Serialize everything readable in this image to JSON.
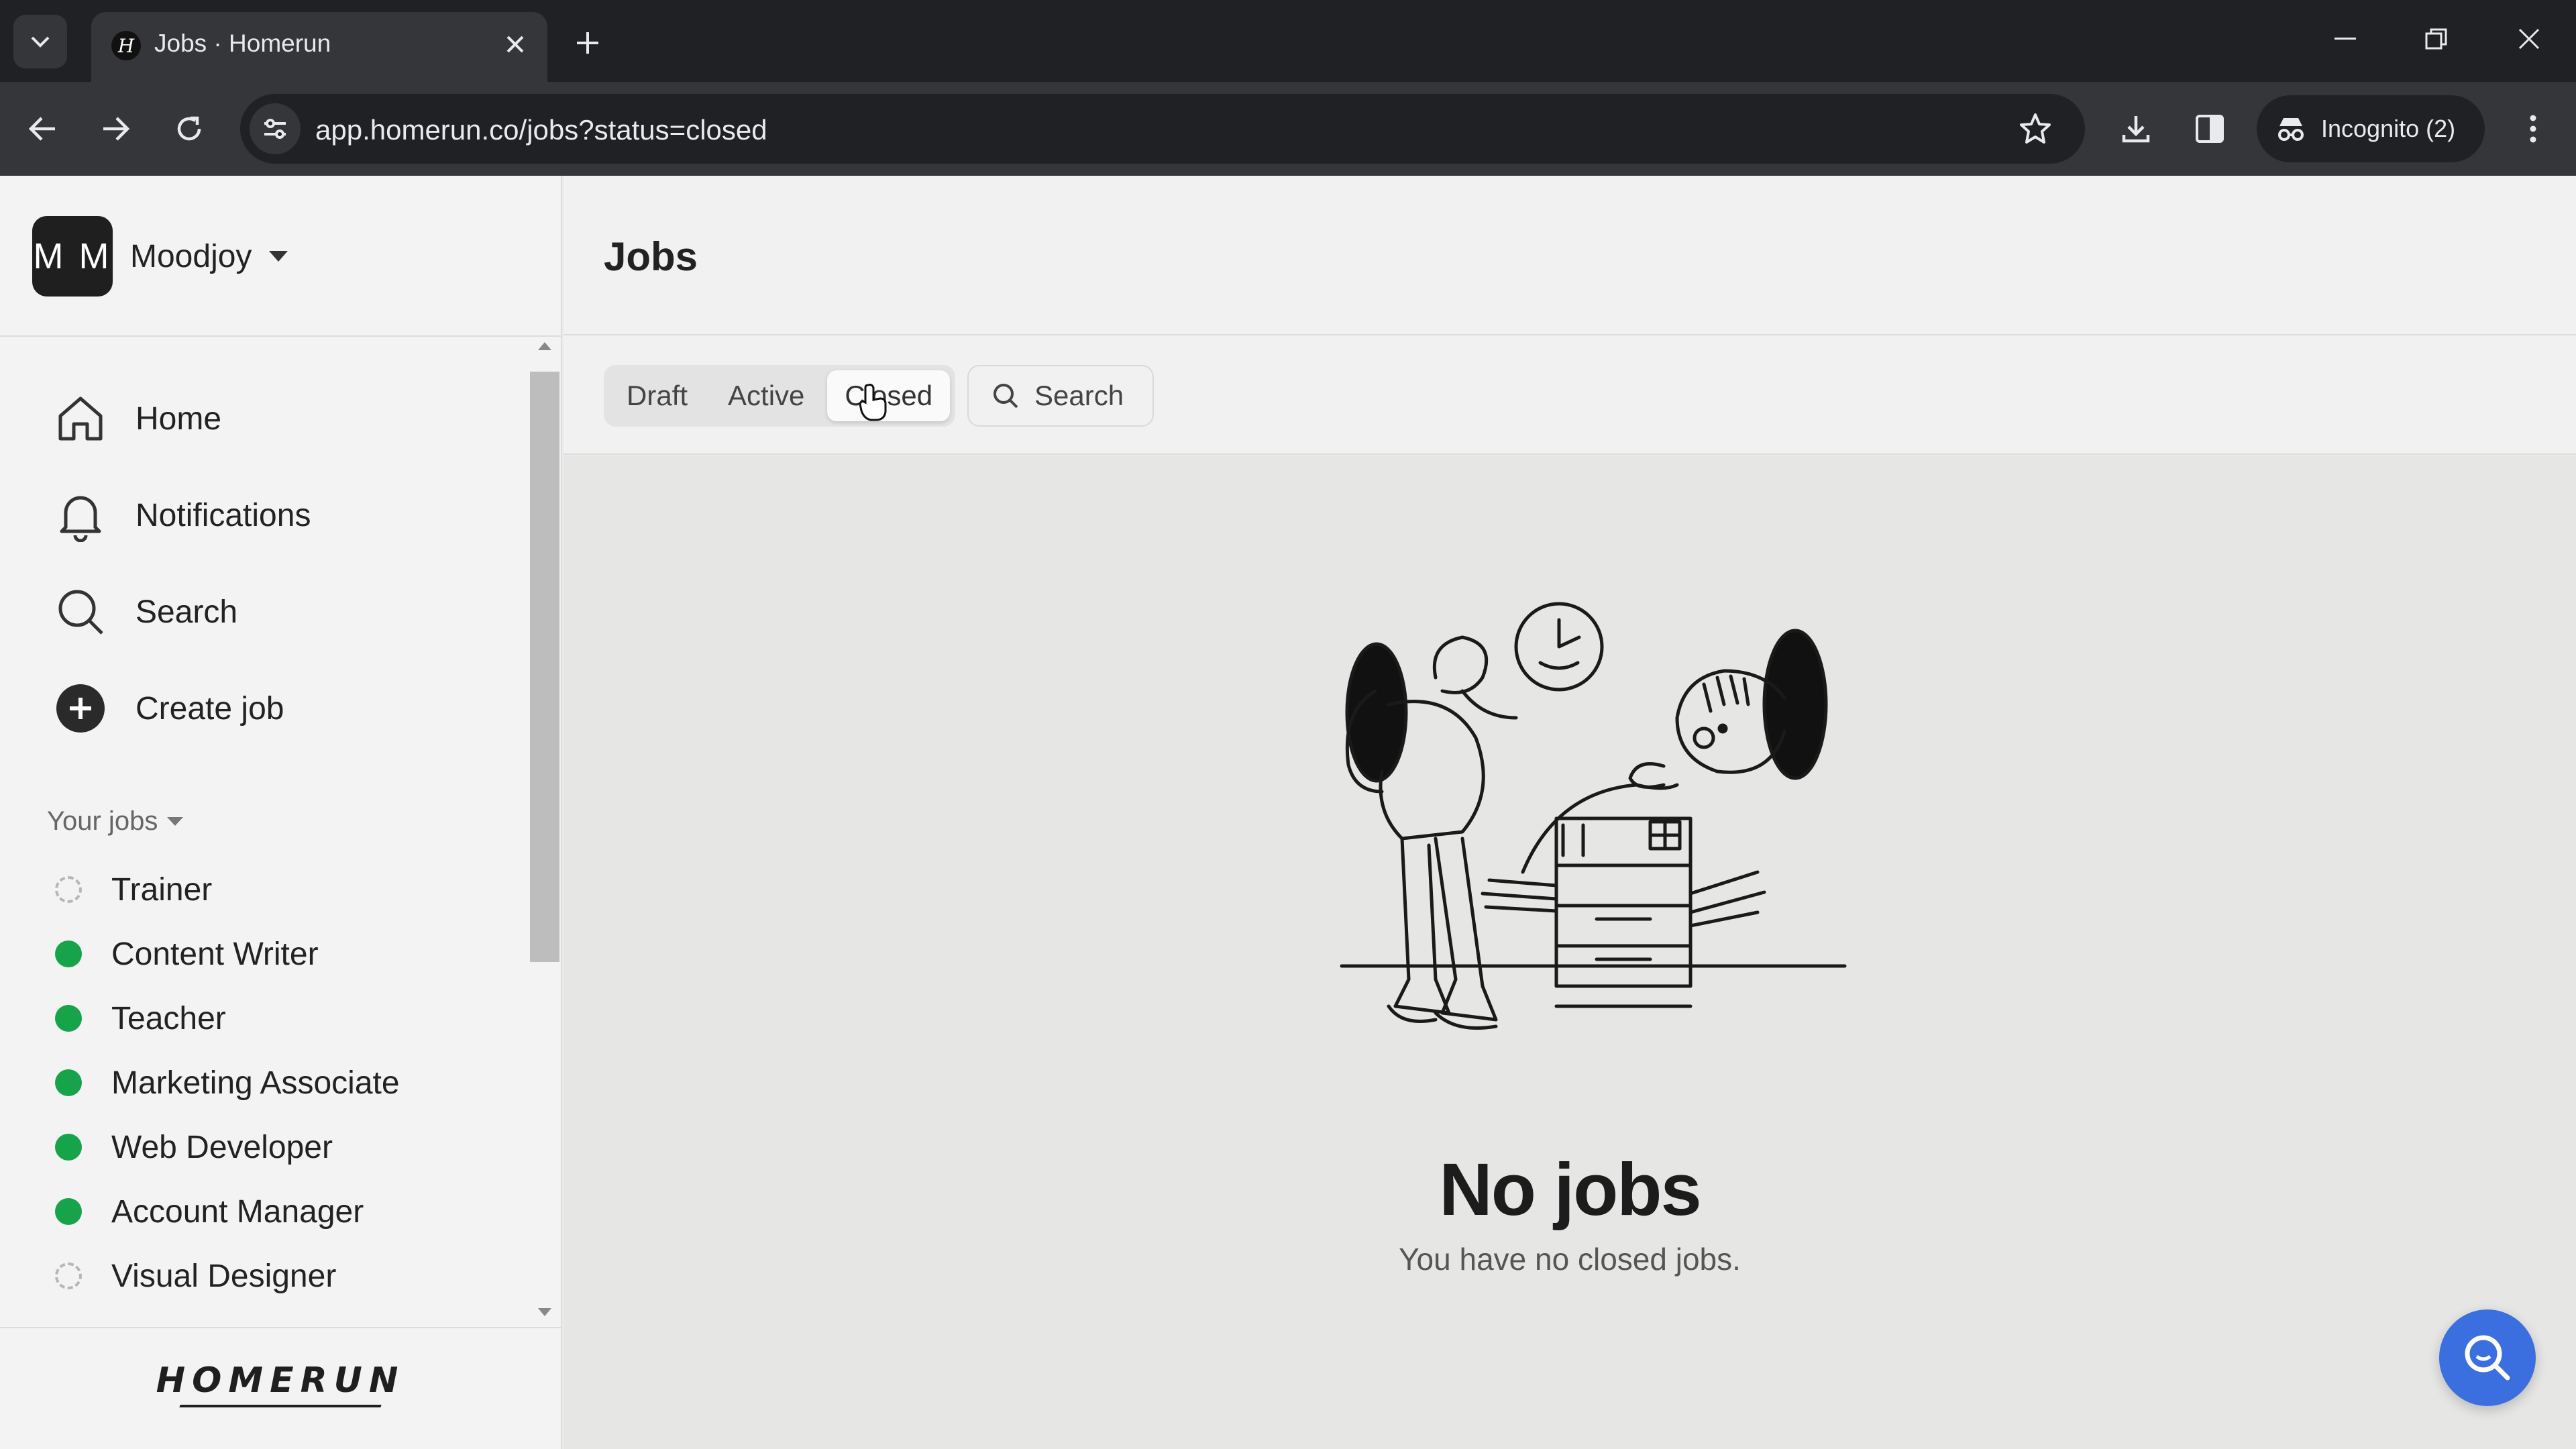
{
  "browser": {
    "tab_title": "Jobs · Homerun",
    "url": "app.homerun.co/jobs?status=closed",
    "incognito_label": "Incognito (2)"
  },
  "sidebar": {
    "org_initials": "M M",
    "org_name": "Moodjoy",
    "nav": [
      {
        "label": "Home",
        "icon": "home-icon"
      },
      {
        "label": "Notifications",
        "icon": "bell-icon"
      },
      {
        "label": "Search",
        "icon": "search-icon"
      },
      {
        "label": "Create job",
        "icon": "plus-circle-icon"
      }
    ],
    "your_jobs_label": "Your jobs",
    "jobs": [
      {
        "label": "Trainer",
        "status": "draft"
      },
      {
        "label": "Content Writer",
        "status": "active"
      },
      {
        "label": "Teacher",
        "status": "active"
      },
      {
        "label": "Marketing Associate",
        "status": "active"
      },
      {
        "label": "Web Developer",
        "status": "active"
      },
      {
        "label": "Account Manager",
        "status": "active"
      },
      {
        "label": "Visual Designer",
        "status": "draft"
      }
    ],
    "brand": "HOMERUN"
  },
  "main": {
    "title": "Jobs",
    "filters": [
      "Draft",
      "Active",
      "Closed"
    ],
    "selected_filter": "Closed",
    "search_label": "Search",
    "empty_title": "No jobs",
    "empty_subtitle": "You have no closed jobs."
  },
  "colors": {
    "active_status": "#16a34a",
    "help_button": "#3b6fe0"
  }
}
